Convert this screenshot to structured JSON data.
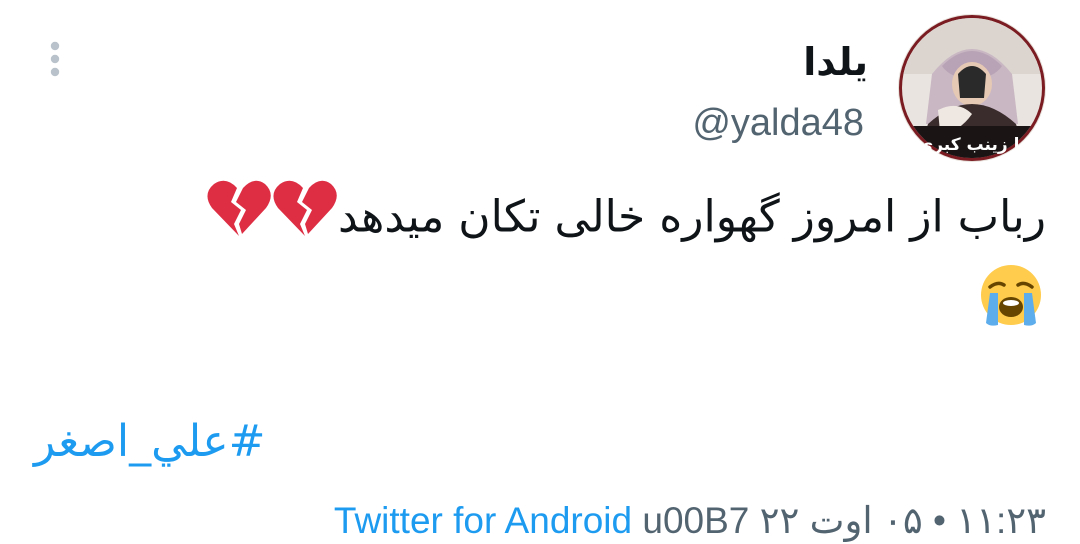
{
  "tweet": {
    "author": {
      "display_name": "يلدا",
      "handle": "@yalda48",
      "avatar_caption": "یا زینب کبری"
    },
    "text": "رباب از امروز گهواره خالی تکان میدهد",
    "emojis": {
      "broken_heart": "broken-heart-emoji",
      "crying": "loudly-crying-face-emoji"
    },
    "hashtag": "#علي_اصغر",
    "meta": {
      "time_date": "۱۱:۲۳ • ۰۵ اوت ۲۲",
      "separator": " u00B7 ",
      "source": "Twitter for Android"
    },
    "colors": {
      "link": "#1d9bf0",
      "secondary_text": "#536471",
      "primary_text": "#0f1419"
    },
    "icons": {
      "more": "more-vertical-icon"
    }
  }
}
